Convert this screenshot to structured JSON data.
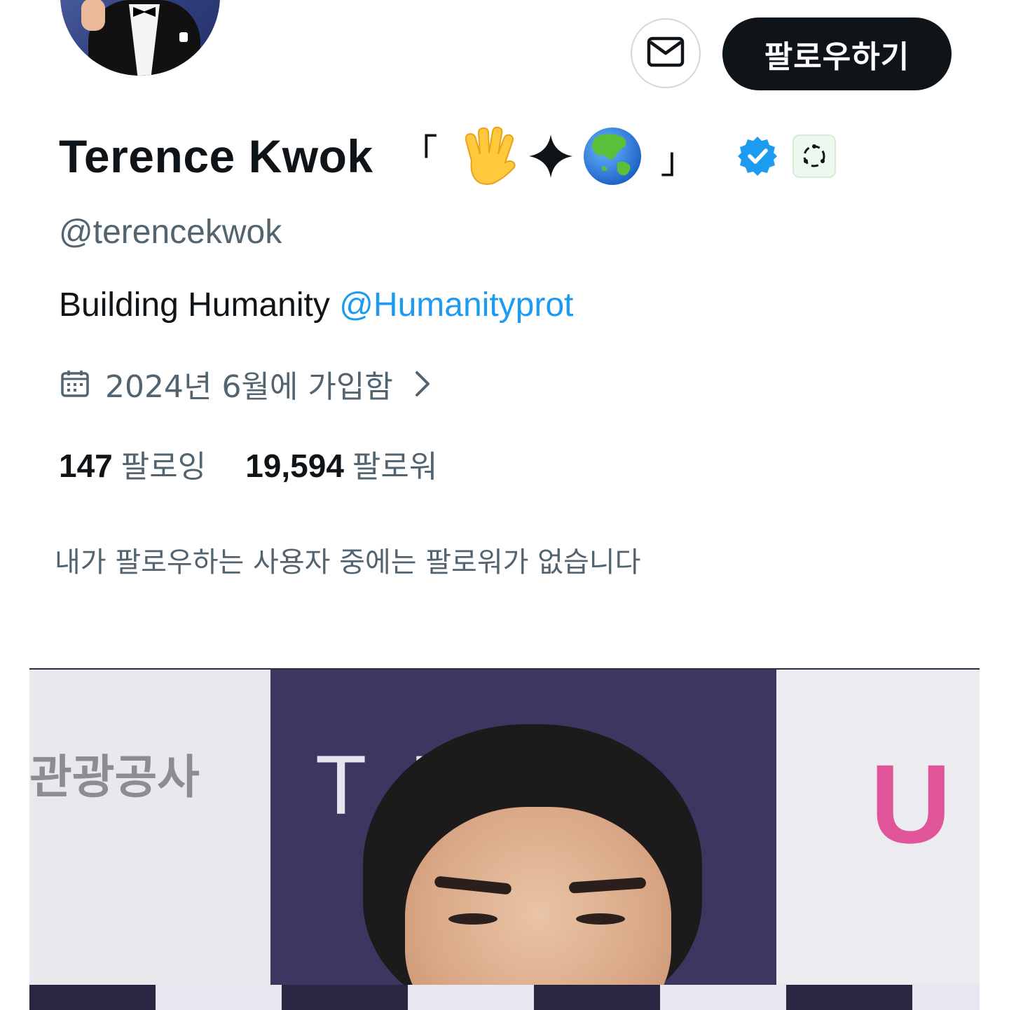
{
  "profile": {
    "display_name": "Terence Kwok",
    "name_bracket_open": "「",
    "name_bracket_close": "」",
    "name_emojis": [
      "raised-hand-icon",
      "sparkle-icon",
      "globe-asia-icon"
    ],
    "handle": "@terencekwok",
    "bio_text": "Building Humanity ",
    "bio_mention": "@Humanityprot",
    "joined": "2024년 6월에 가입함",
    "following_count": "147",
    "following_label": "팔로잉",
    "followers_count": "19,594",
    "followers_label": "팔로워",
    "mutual_note": "내가 팔로우하는 사용자 중에는 팔로워가 없습니다",
    "verified": true,
    "affiliate_badge_icon": "humanity-protocol-badge-icon"
  },
  "actions": {
    "message_icon": "envelope-icon",
    "follow_label": "팔로우하기"
  },
  "media": {
    "sign_left": "관광공사",
    "sign_mid": "TI R",
    "sign_right": "U"
  },
  "colors": {
    "text_primary": "#0f1419",
    "text_secondary": "#536471",
    "link": "#1d9bf0",
    "verified_badge": "#1d9bf0",
    "follow_button_bg": "#0f1419"
  }
}
